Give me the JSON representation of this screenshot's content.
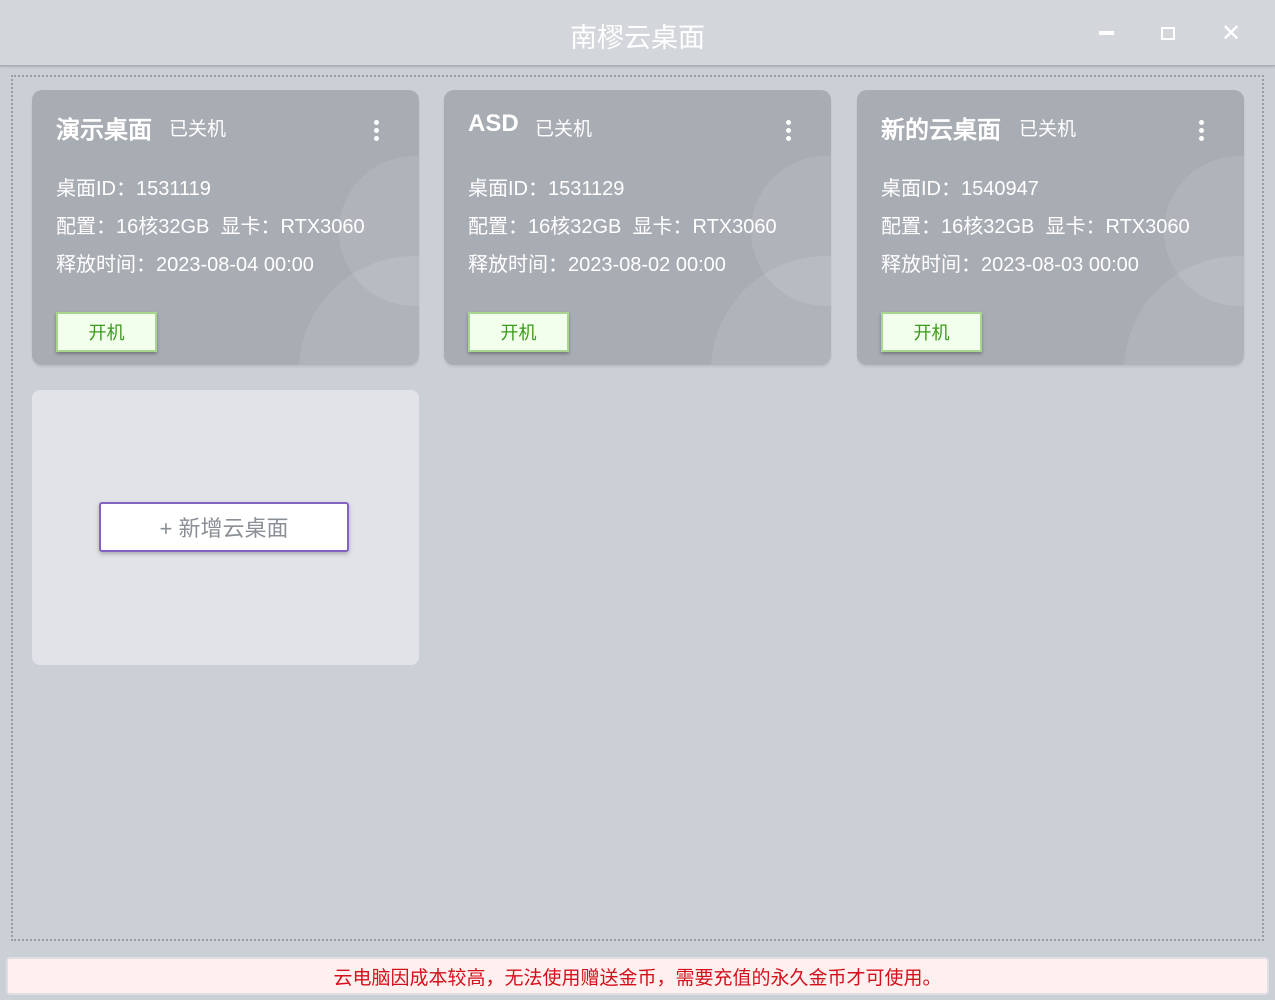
{
  "window": {
    "title": "南樛云桌面",
    "minimize": "minimize",
    "maximize": "maximize",
    "close": "✕"
  },
  "desktops": [
    {
      "name": "演示桌面",
      "status": "已关机",
      "id_line": "桌面ID：1531119",
      "config_line": "配置：16核32GB  显卡：RTX3060",
      "release_line": "释放时间：2023-08-04 00:00",
      "start_label": "开机"
    },
    {
      "name": "ASD",
      "status": "已关机",
      "id_line": "桌面ID：1531129",
      "config_line": "配置：16核32GB  显卡：RTX3060",
      "release_line": "释放时间：2023-08-02 00:00",
      "start_label": "开机"
    },
    {
      "name": "新的云桌面",
      "status": "已关机",
      "id_line": "桌面ID：1540947",
      "config_line": "配置：16核32GB  显卡：RTX3060",
      "release_line": "释放时间：2023-08-03 00:00",
      "start_label": "开机"
    }
  ],
  "add_button": "+ 新增云桌面",
  "notice": "云电脑因成本较高，无法使用赠送金币，需要充值的永久金币才可使用。"
}
